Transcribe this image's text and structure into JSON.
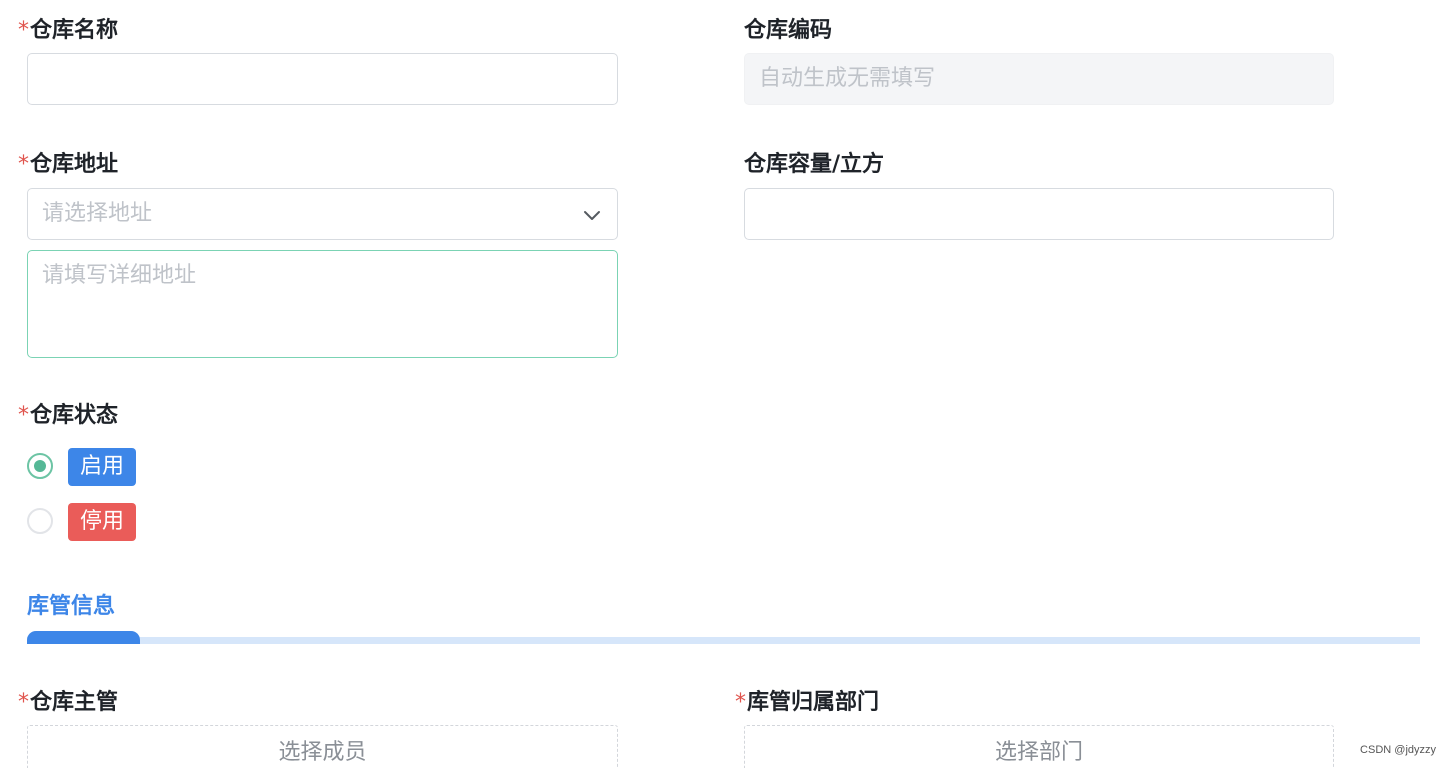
{
  "required_mark": "*",
  "fields": {
    "warehouse_name": {
      "label": "仓库名称",
      "value": ""
    },
    "warehouse_code": {
      "label": "仓库编码",
      "placeholder": "自动生成无需填写"
    },
    "warehouse_address": {
      "label": "仓库地址",
      "select_placeholder": "请选择地址",
      "detail_placeholder": "请填写详细地址"
    },
    "warehouse_capacity": {
      "label": "仓库容量/立方",
      "value": ""
    },
    "warehouse_status": {
      "label": "仓库状态",
      "options": [
        {
          "label": "启用",
          "checked": true,
          "color": "#3d86e8"
        },
        {
          "label": "停用",
          "checked": false,
          "color": "#ea5c59"
        }
      ]
    }
  },
  "section": {
    "title": "库管信息"
  },
  "manager": {
    "supervisor": {
      "label": "仓库主管",
      "button": "选择成员"
    },
    "department": {
      "label": "库管归属部门",
      "button": "选择部门"
    }
  },
  "watermark": "CSDN @jdyzzy",
  "icons": {
    "address_dropdown": "chevron-down-icon"
  }
}
